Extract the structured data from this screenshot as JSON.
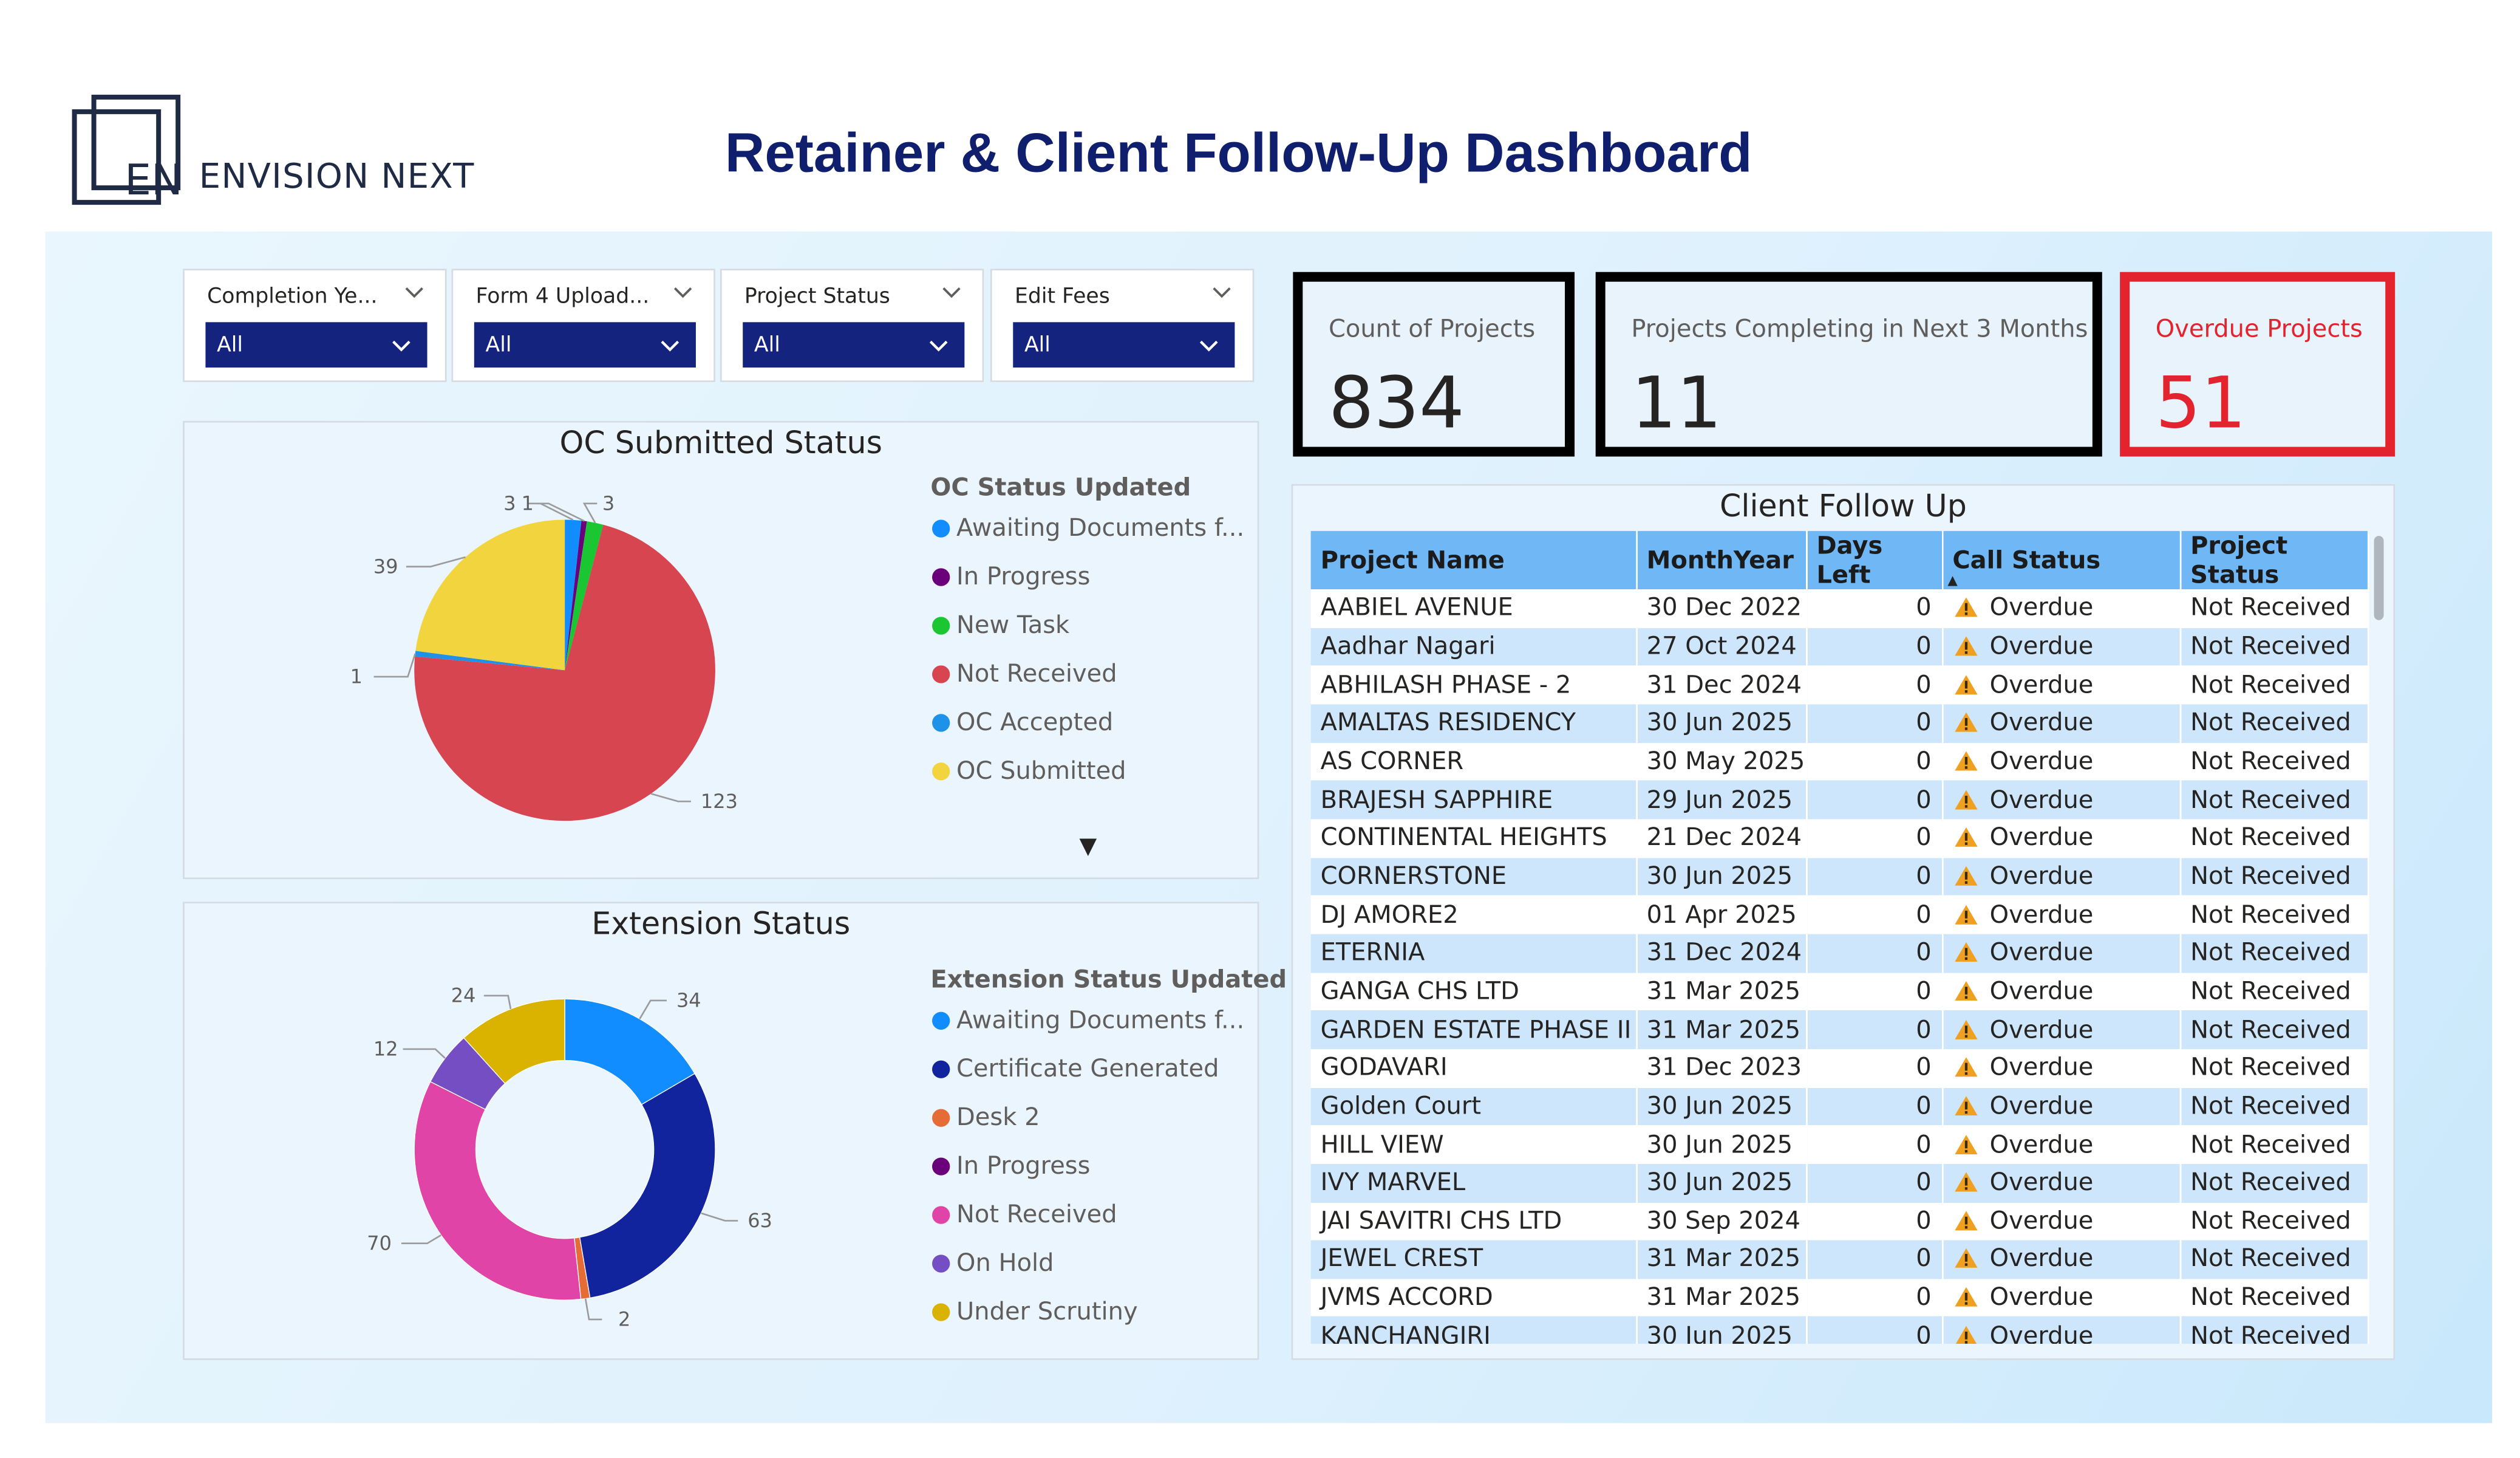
{
  "header": {
    "logo_mark": "EN",
    "brand_name": "ENVISION NEXT",
    "title": "Retainer & Client Follow-Up Dashboard"
  },
  "slicers": [
    {
      "label": "Completion Ye...",
      "value": "All"
    },
    {
      "label": "Form 4 Upload...",
      "value": "All"
    },
    {
      "label": "Project Status",
      "value": "All"
    },
    {
      "label": "Edit Fees",
      "value": "All"
    }
  ],
  "cards": {
    "count": {
      "label": "Count of Projects",
      "value": "834"
    },
    "next3": {
      "label": "Projects Completing in Next 3 Months",
      "value": "11"
    },
    "overdue": {
      "label": "Overdue Projects",
      "value": "51"
    }
  },
  "colors": {
    "accent": "#14237e",
    "overdue": "#e3242e",
    "header_row": "#6fb8f5",
    "alt_row": "#cde6fb",
    "warning": "#f0a020"
  },
  "chart_data": [
    {
      "type": "pie",
      "title": "OC Submitted Status",
      "legend_title": "OC Status Updated",
      "legend_placement": "right",
      "categories": [
        "Awaiting Documents f...",
        "In Progress",
        "New Task",
        "Not Received",
        "OC Accepted",
        "OC Submitted"
      ],
      "colors": [
        "#118dff",
        "#6b007b",
        "#1ac631",
        "#d64550",
        "#1e91e8",
        "#f2d43e"
      ],
      "values": [
        3,
        1,
        3,
        123,
        1,
        39
      ],
      "data_labels": [
        "3",
        "1",
        "3",
        "123",
        "1",
        "39"
      ],
      "more_indicator": "▼"
    },
    {
      "type": "donut",
      "title": "Extension Status",
      "legend_title": "Extension Status Updated",
      "legend_placement": "right",
      "categories": [
        "Awaiting Documents f...",
        "Certificate Generated",
        "Desk 2",
        "In Progress",
        "Not Received",
        "On Hold",
        "Under Scrutiny"
      ],
      "colors": [
        "#118dff",
        "#12239e",
        "#e66c37",
        "#6b007b",
        "#e044a7",
        "#744ec2",
        "#d9b300"
      ],
      "values": [
        34,
        63,
        2,
        0,
        70,
        12,
        24
      ],
      "data_labels": [
        "34",
        "63",
        "2",
        "",
        "70",
        "12",
        "24"
      ]
    }
  ],
  "table": {
    "title": "Client Follow Up",
    "columns": [
      "Project Name",
      "MonthYear",
      "Days Left",
      "Call Status",
      "Project Status"
    ],
    "sort_indicator": "▲",
    "rows": [
      [
        "AABIEL AVENUE",
        "30 Dec 2022",
        "0",
        "Overdue",
        "Not Received"
      ],
      [
        "Aadhar Nagari",
        "27 Oct 2024",
        "0",
        "Overdue",
        "Not Received"
      ],
      [
        "ABHILASH PHASE - 2",
        "31 Dec 2024",
        "0",
        "Overdue",
        "Not Received"
      ],
      [
        "AMALTAS RESIDENCY",
        "30 Jun 2025",
        "0",
        "Overdue",
        "Not Received"
      ],
      [
        "AS CORNER",
        "30 May 2025",
        "0",
        "Overdue",
        "Not Received"
      ],
      [
        "BRAJESH SAPPHIRE",
        "29 Jun 2025",
        "0",
        "Overdue",
        "Not Received"
      ],
      [
        "CONTINENTAL HEIGHTS",
        "21 Dec 2024",
        "0",
        "Overdue",
        "Not Received"
      ],
      [
        "CORNERSTONE",
        "30 Jun 2025",
        "0",
        "Overdue",
        "Not Received"
      ],
      [
        "DJ AMORE2",
        "01 Apr 2025",
        "0",
        "Overdue",
        "Not Received"
      ],
      [
        "ETERNIA",
        "31 Dec 2024",
        "0",
        "Overdue",
        "Not Received"
      ],
      [
        "GANGA CHS LTD",
        "31 Mar 2025",
        "0",
        "Overdue",
        "Not Received"
      ],
      [
        "GARDEN ESTATE PHASE II",
        "31 Mar 2025",
        "0",
        "Overdue",
        "Not Received"
      ],
      [
        "GODAVARI",
        "31 Dec 2023",
        "0",
        "Overdue",
        "Not Received"
      ],
      [
        "Golden Court",
        "30 Jun 2025",
        "0",
        "Overdue",
        "Not Received"
      ],
      [
        "HILL VIEW",
        "30 Jun 2025",
        "0",
        "Overdue",
        "Not Received"
      ],
      [
        "IVY MARVEL",
        "30 Jun 2025",
        "0",
        "Overdue",
        "Not Received"
      ],
      [
        "JAI SAVITRI CHS LTD",
        "30 Sep 2024",
        "0",
        "Overdue",
        "Not Received"
      ],
      [
        "JEWEL CREST",
        "31 Mar 2025",
        "0",
        "Overdue",
        "Not Received"
      ],
      [
        "JVMS ACCORD",
        "31 Mar 2025",
        "0",
        "Overdue",
        "Not Received"
      ],
      [
        "KANCHANGIRI",
        "30 Jun 2025",
        "0",
        "Overdue",
        "Not Received"
      ]
    ]
  }
}
